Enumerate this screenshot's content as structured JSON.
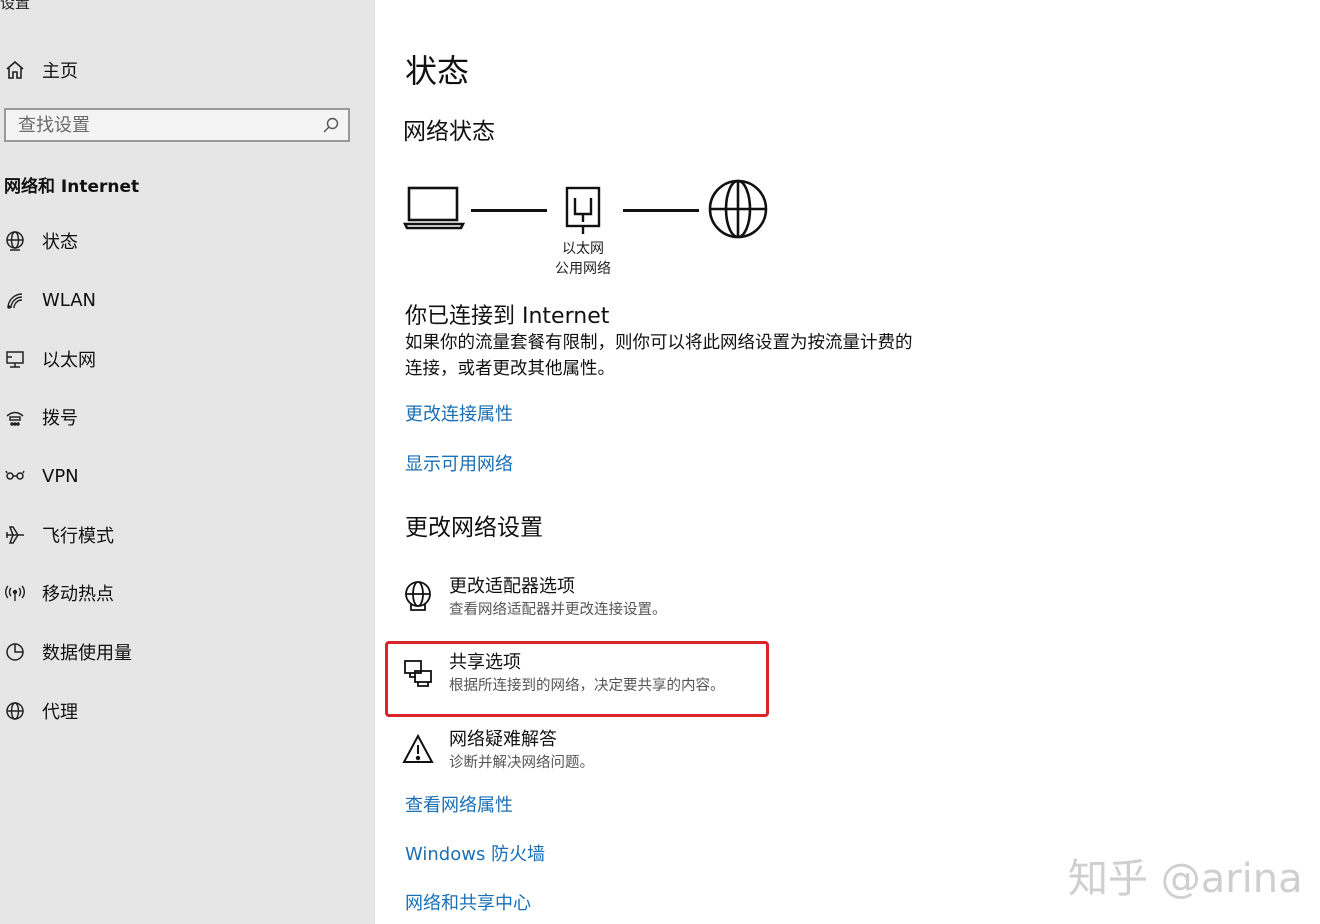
{
  "app": {
    "title": "设置"
  },
  "sidebar": {
    "home_label": "主页",
    "search": {
      "placeholder": "查找设置",
      "value": ""
    },
    "section_heading": "网络和 Internet",
    "items": [
      {
        "label": "状态",
        "icon": "globe-status-icon"
      },
      {
        "label": "WLAN",
        "icon": "wifi-icon"
      },
      {
        "label": "以太网",
        "icon": "ethernet-icon"
      },
      {
        "label": "拨号",
        "icon": "dialup-icon"
      },
      {
        "label": "VPN",
        "icon": "vpn-icon"
      },
      {
        "label": "飞行模式",
        "icon": "airplane-icon"
      },
      {
        "label": "移动热点",
        "icon": "hotspot-icon"
      },
      {
        "label": "数据使用量",
        "icon": "data-usage-icon"
      },
      {
        "label": "代理",
        "icon": "globe-icon"
      }
    ]
  },
  "main": {
    "page_title": "状态",
    "network_status_heading": "网络状态",
    "diagram": {
      "adapter_name": "以太网",
      "network_type": "公用网络"
    },
    "connected_heading": "你已连接到 Internet",
    "connected_desc": "如果你的流量套餐有限制，则你可以将此网络设置为按流量计费的连接，或者更改其他属性。",
    "links_top": [
      "更改连接属性",
      "显示可用网络"
    ],
    "change_settings_heading": "更改网络设置",
    "options": [
      {
        "title": "更改适配器选项",
        "subtitle": "查看网络适配器并更改连接设置。",
        "icon": "adapter-icon"
      },
      {
        "title": "共享选项",
        "subtitle": "根据所连接到的网络，决定要共享的内容。",
        "icon": "sharing-icon"
      },
      {
        "title": "网络疑难解答",
        "subtitle": "诊断并解决网络问题。",
        "icon": "warning-icon"
      }
    ],
    "links_bottom": [
      "查看网络属性",
      "Windows 防火墙",
      "网络和共享中心"
    ]
  },
  "watermark": "知乎 @arina",
  "colors": {
    "link": "#1a6fb5",
    "highlight": "#d9242a",
    "sidebar_bg": "#e6e6e6"
  }
}
